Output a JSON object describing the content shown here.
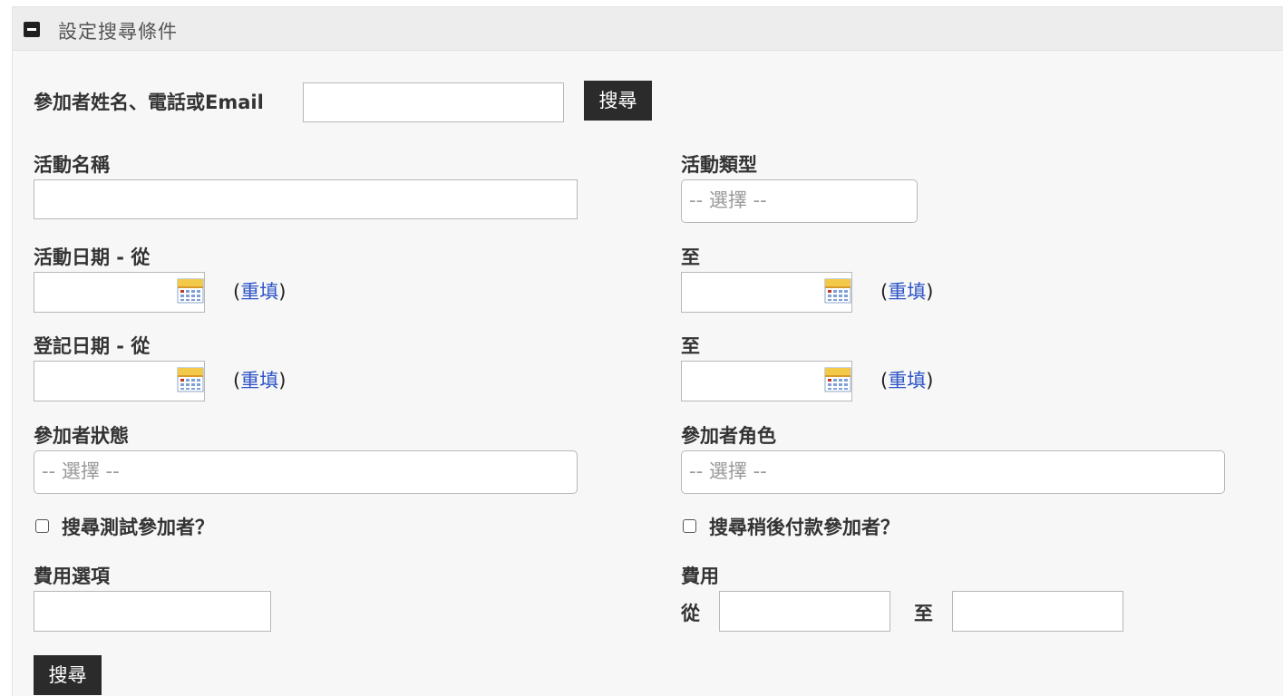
{
  "panel": {
    "title": "設定搜尋條件"
  },
  "quick_search": {
    "label": "參加者姓名、電話或Email",
    "value": "",
    "button_label": "搜尋"
  },
  "event_name": {
    "label": "活動名稱",
    "value": ""
  },
  "event_type": {
    "label": "活動類型",
    "selected": "-- 選擇 --"
  },
  "event_date_from": {
    "label": "活動日期 - 從",
    "value": ""
  },
  "event_date_to": {
    "label": "至",
    "value": ""
  },
  "register_date_from": {
    "label": "登記日期 - 從",
    "value": ""
  },
  "register_date_to": {
    "label": "至",
    "value": ""
  },
  "reset": {
    "open": "(",
    "label": "重填",
    "close": ")"
  },
  "participant_status": {
    "label": "參加者狀態",
    "selected": "-- 選擇 --"
  },
  "participant_role": {
    "label": "參加者角色",
    "selected": "-- 選擇 --"
  },
  "test_participants": {
    "label": "搜尋測試參加者？",
    "checked": false
  },
  "pay_later": {
    "label": "搜尋稍後付款參加者？",
    "checked": false
  },
  "fee_option": {
    "label": "費用選項",
    "value": ""
  },
  "fee": {
    "label": "費用",
    "from_label": "從",
    "to_label": "至",
    "from_value": "",
    "to_value": ""
  },
  "submit": {
    "label": "搜尋"
  },
  "colors": {
    "button_bg": "#2b2b2b",
    "link": "#2e54c7",
    "panel_bg": "#f7f7f7",
    "header_bg": "#ededed"
  },
  "icons": {
    "collapse": "minus-square-icon",
    "calendar": "calendar-icon"
  }
}
